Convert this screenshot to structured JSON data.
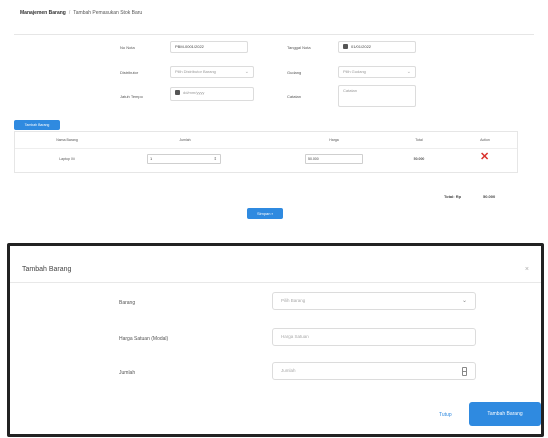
{
  "breadcrumb": {
    "root": "Manajemen Barang",
    "separator": "/",
    "current": "Tambah Pemasukan Stok Baru"
  },
  "form": {
    "no_nota_label": "No Nota",
    "no_nota_value": "PBM-0001/2022",
    "tanggal_label": "Tanggal Nota",
    "tanggal_value": "01/01/2022",
    "distributor_label": "Distributor",
    "distributor_placeholder": "Pilih Distributor Barang",
    "gudang_label": "Gudang",
    "gudang_placeholder": "Pilih Gudang",
    "jatuh_tempo_label": "Jatuh Tempo",
    "jatuh_tempo_placeholder": "dd/mm/yyyy",
    "catatan_label": "Catatan",
    "catatan_placeholder": "Catatan"
  },
  "items": {
    "add_button": "Tambah Barang",
    "columns": [
      "Nama Barang",
      "Jumlah",
      "Harga",
      "Total",
      "Action"
    ],
    "rows": [
      {
        "name": "Laptop Xii",
        "qty": "1",
        "price": "50.000",
        "total": "50.000"
      }
    ],
    "delete_icon": "close-x-icon"
  },
  "summary": {
    "total_label": "Total: Rp",
    "total_value": "50.000"
  },
  "save_button": "Simpan",
  "modal": {
    "title": "Tambah Barang",
    "close_glyph": "×",
    "fields": [
      {
        "label": "Barang",
        "placeholder": "Pilih Barang",
        "kind": "select"
      },
      {
        "label": "Harga Satuan (Modal)",
        "placeholder": "Harga Satuan",
        "kind": "text"
      },
      {
        "label": "Jumlah",
        "placeholder": "Jumlah",
        "kind": "number"
      }
    ],
    "close_button": "Tutup",
    "submit_button": "Tambah Barang"
  },
  "colors": {
    "accent": "#2f8ae0",
    "danger": "#d9302b"
  }
}
